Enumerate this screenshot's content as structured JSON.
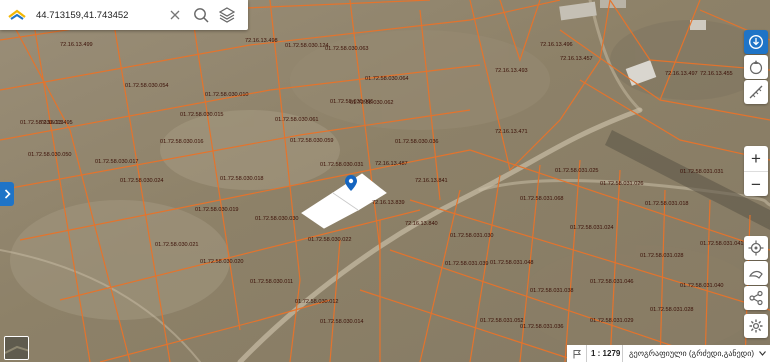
{
  "search": {
    "value": "44.713159,41.743452",
    "placeholder": ""
  },
  "icons": {
    "logo": "agency-logo-icon",
    "clear": "close-icon",
    "search": "search-icon",
    "layers": "layers-icon",
    "expand": "chevron-right-icon",
    "info": "info-icon",
    "compass": "compass-icon",
    "measure": "measure-icon",
    "zoom_in": "plus-icon",
    "zoom_out": "minus-icon",
    "locate": "crosshair-icon",
    "draw": "draw-icon",
    "share": "share-icon",
    "settings": "gear-icon",
    "marker": "location-pin-icon",
    "flag": "flag-icon"
  },
  "zoom": {
    "in_label": "+",
    "out_label": "−"
  },
  "status": {
    "scale": "1 : 1279",
    "language": "გეოგრაფიული (გრძედი,განედი)"
  },
  "colors": {
    "parcel_line": "#e8732a",
    "accent": "#1f74c7",
    "selected_fill": "#ffffff",
    "marker": "#1565c0"
  },
  "parcels": [
    "72.16.13.499",
    "01.72.58.030.124",
    "72.16.13.498",
    "01.72.58.030.063",
    "01.72.58.030.054",
    "01.72.58.030.064",
    "01.72.58.030.010",
    "01.72.58.030.065",
    "01.72.58.030.062",
    "01.72.58.030.015",
    "01.72.58.030.061",
    "72.16.13.496",
    "72.16.13.497",
    "72.16.13.471",
    "01.72.58.030.016",
    "01.72.58.030.036",
    "01.72.58.030.059",
    "01.72.58.030.017",
    "01.72.58.030.031",
    "72.16.13.487",
    "72.16.13.495",
    "01.72.58.030.013",
    "01.72.58.030.018",
    "01.72.58.030.024",
    "01.72.58.030.050",
    "01.72.58.030.019",
    "72.16.13.841",
    "01.72.58.030.030",
    "72.16.13.839",
    "01.72.58.030.022",
    "01.72.58.030.021",
    "01.72.58.030.020",
    "01.72.58.030.011",
    "01.72.58.030.012",
    "01.72.58.030.014",
    "01.72.58.031.030",
    "01.72.58.031.039",
    "01.72.58.031.068",
    "01.72.58.031.025",
    "01.72.58.031.024",
    "01.72.58.031.048",
    "01.72.58.031.046",
    "01.72.58.031.038",
    "01.72.58.031.028",
    "01.72.58.031.018",
    "01.72.58.031.028",
    "01.72.58.031.029",
    "01.72.58.031.040",
    "01.72.58.031.041",
    "01.72.58.031.031",
    "72.16.13.493",
    "72.16.13.457",
    "72.16.13.455",
    "72.16.13.840",
    "01.72.58.031.052",
    "01.72.58.031.026",
    "01.72.58.031.036"
  ]
}
